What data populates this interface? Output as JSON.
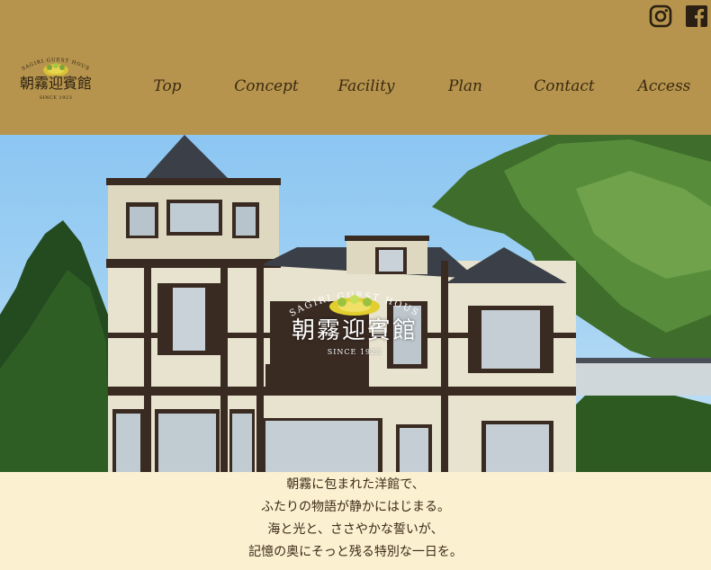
{
  "brand": {
    "arc_text": "ASAGIRI GUEST HOUSE",
    "name_kanji": "朝霧迎賓館",
    "since": "SINCE 1923",
    "accent": "#b6944d",
    "wreath_color": "#d9c235"
  },
  "nav": {
    "items": [
      {
        "label": "Top"
      },
      {
        "label": "Concept"
      },
      {
        "label": "Facility"
      },
      {
        "label": "Plan"
      },
      {
        "label": "Contact"
      },
      {
        "label": "Access"
      }
    ]
  },
  "social": {
    "icons": [
      "instagram-icon",
      "facebook-icon"
    ]
  },
  "hero": {
    "overlay_arc_text": "ASAGIRI GUEST HOUSE",
    "overlay_name": "朝霧迎賓館",
    "overlay_since": "SINCE 1923"
  },
  "intro": {
    "lines": [
      "朝霧に包まれた洋館で、",
      "ふたりの物語が静かにはじまる。",
      "海と光と、ささやかな誓いが、",
      "記憶の奥にそっと残る特別な一日を。"
    ]
  }
}
